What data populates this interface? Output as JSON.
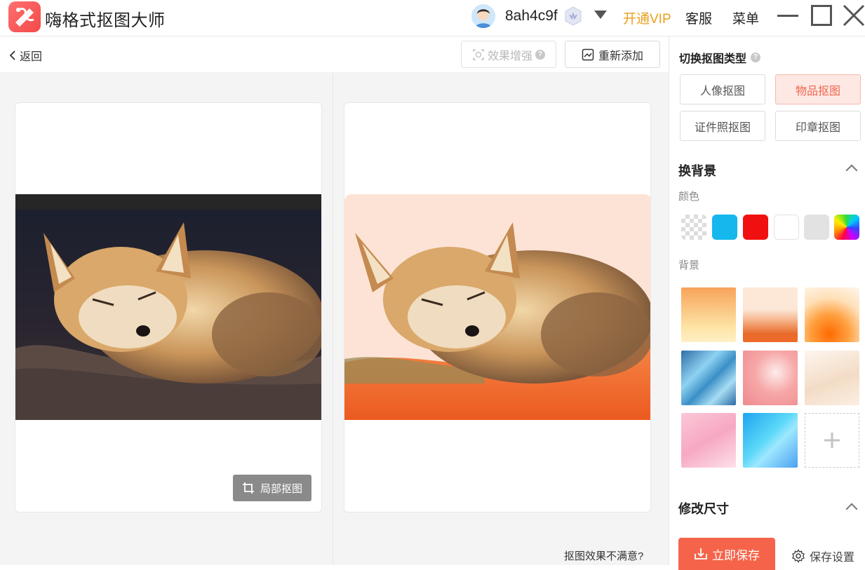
{
  "app": {
    "title": "嗨格式抠图大师",
    "username": "8ah4c9f",
    "vip_label": "开通VIP",
    "service_label": "客服",
    "menu_label": "菜单"
  },
  "toolbar": {
    "back_label": "返回",
    "enhance_label": "效果增强",
    "readd_label": "重新添加"
  },
  "workspace": {
    "local_cut_label": "局部抠图",
    "unsatisfied_label": "抠图效果不满意?"
  },
  "panel": {
    "type_title": "切换抠图类型",
    "types": [
      {
        "label": "人像抠图",
        "active": false
      },
      {
        "label": "物品抠图",
        "active": true
      },
      {
        "label": "证件照抠图",
        "active": false
      },
      {
        "label": "印章抠图",
        "active": false
      }
    ],
    "bg_section_title": "换背景",
    "color_label": "颜色",
    "colors": [
      "transparent",
      "#14b8ec",
      "#f11010",
      "#ffffff",
      "#e2e2e2",
      "rainbow"
    ],
    "background_label": "背景",
    "resize_section_title": "修改尺寸",
    "save_label": "立即保存",
    "save_settings_label": "保存设置"
  },
  "colors": {
    "accent": "#f5644a",
    "vip": "#e9a01c"
  }
}
